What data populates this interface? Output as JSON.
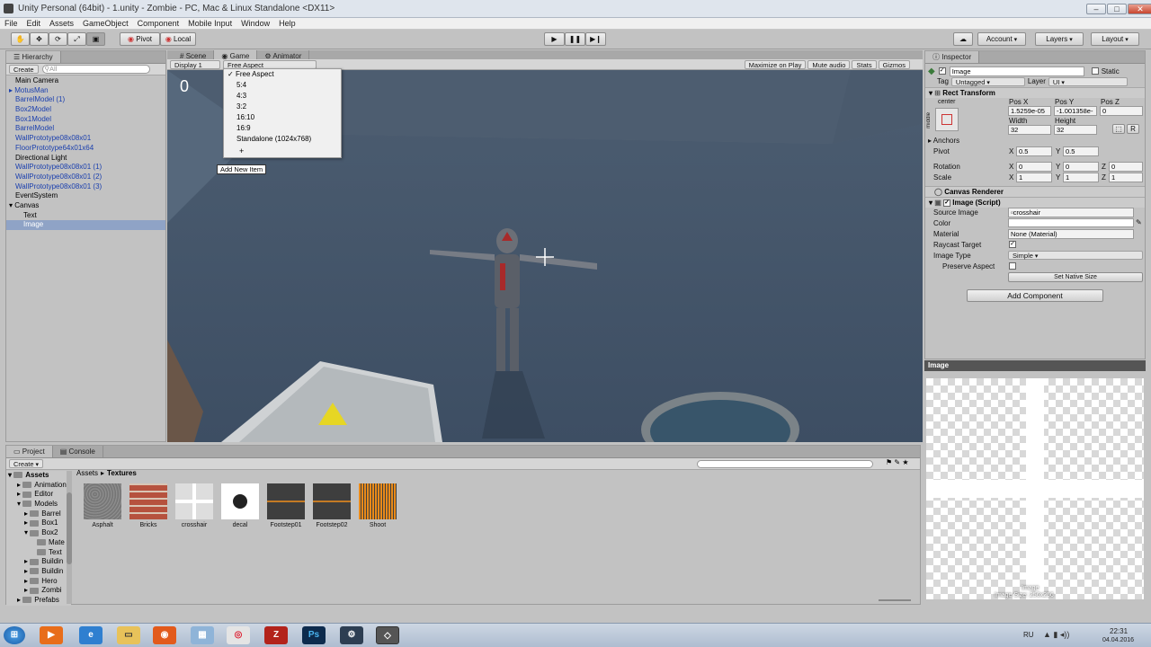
{
  "window": {
    "title": "Unity Personal (64bit) - 1.unity - Zombie - PC, Mac & Linux Standalone <DX11>"
  },
  "menu": [
    "File",
    "Edit",
    "Assets",
    "GameObject",
    "Component",
    "Mobile Input",
    "Window",
    "Help"
  ],
  "toolbar": {
    "pivot": "Pivot",
    "local": "Local",
    "account": "Account",
    "layers": "Layers",
    "layout": "Layout"
  },
  "hierarchy": {
    "tab": "Hierarchy",
    "create": "Create",
    "search_placeholder": "All",
    "items": [
      "Main Camera",
      "MotusMan",
      "BarrelModel (1)",
      "Box2Model",
      "Box1Model",
      "BarrelModel",
      "WallPrototype08x08x01",
      "FloorPrototype64x01x64",
      "Directional Light",
      "WallPrototype08x08x01 (1)",
      "WallPrototype08x08x01 (2)",
      "WallPrototype08x08x01 (3)",
      "EventSystem",
      "Canvas",
      "Text",
      "Image"
    ]
  },
  "scene_tabs": {
    "scene": "Scene",
    "game": "Game",
    "animator": "Animator"
  },
  "game": {
    "display": "Display 1",
    "aspect": "Free Aspect",
    "maximize": "Maximize on Play",
    "mute": "Mute audio",
    "stats": "Stats",
    "gizmos": "Gizmos",
    "score": "0",
    "aspect_menu": [
      "Free Aspect",
      "5:4",
      "4:3",
      "3:2",
      "16:10",
      "16:9",
      "Standalone (1024x768)"
    ],
    "tooltip": "Add New Item"
  },
  "inspector": {
    "tab": "Inspector",
    "name": "Image",
    "static": "Static",
    "tag_label": "Tag",
    "tag": "Untagged",
    "layer_label": "Layer",
    "layer": "UI",
    "rect_transform": "Rect Transform",
    "anchor_h": "center",
    "anchor_v": "middle",
    "posx_label": "Pos X",
    "posy_label": "Pos Y",
    "posz_label": "Pos Z",
    "posx": "1.5259e-05",
    "posy": "-1.001358e-",
    "posz": "0",
    "width_label": "Width",
    "height_label": "Height",
    "width": "32",
    "height": "32",
    "anchors": "Anchors",
    "pivot": "Pivot",
    "pivot_x": "0.5",
    "pivot_y": "0.5",
    "rotation": "Rotation",
    "rot_x": "0",
    "rot_y": "0",
    "rot_z": "0",
    "scale": "Scale",
    "scale_x": "1",
    "scale_y": "1",
    "scale_z": "1",
    "canvas_renderer": "Canvas Renderer",
    "image_script": "Image (Script)",
    "source_image_label": "Source Image",
    "source_image": "crosshair",
    "color_label": "Color",
    "material_label": "Material",
    "material": "None (Material)",
    "raycast_label": "Raycast Target",
    "image_type_label": "Image Type",
    "image_type": "Simple",
    "preserve_label": "Preserve Aspect",
    "native_size": "Set Native Size",
    "add_component": "Add Component",
    "preview_title": "Image",
    "preview_caption_1": "Image",
    "preview_caption_2": "Image Size: 256x256"
  },
  "project": {
    "tab": "Project",
    "console": "Console",
    "create": "Create",
    "breadcrumb_root": "Assets",
    "breadcrumb_leaf": "Textures",
    "tree": [
      "Assets",
      "Animation",
      "Editor",
      "Models",
      "Barrel",
      "Box1",
      "Box2",
      "Mate",
      "Text",
      "Buildin",
      "Buildin",
      "Hero",
      "Zombi",
      "Prefabs"
    ],
    "assets": [
      {
        "name": "Asphalt"
      },
      {
        "name": "Bricks"
      },
      {
        "name": "crosshair"
      },
      {
        "name": "decal"
      },
      {
        "name": "Footstep01"
      },
      {
        "name": "Footstep02"
      },
      {
        "name": "Shoot"
      }
    ]
  },
  "taskbar": {
    "lang": "RU",
    "time": "22:31",
    "date": "04.04.2016"
  }
}
